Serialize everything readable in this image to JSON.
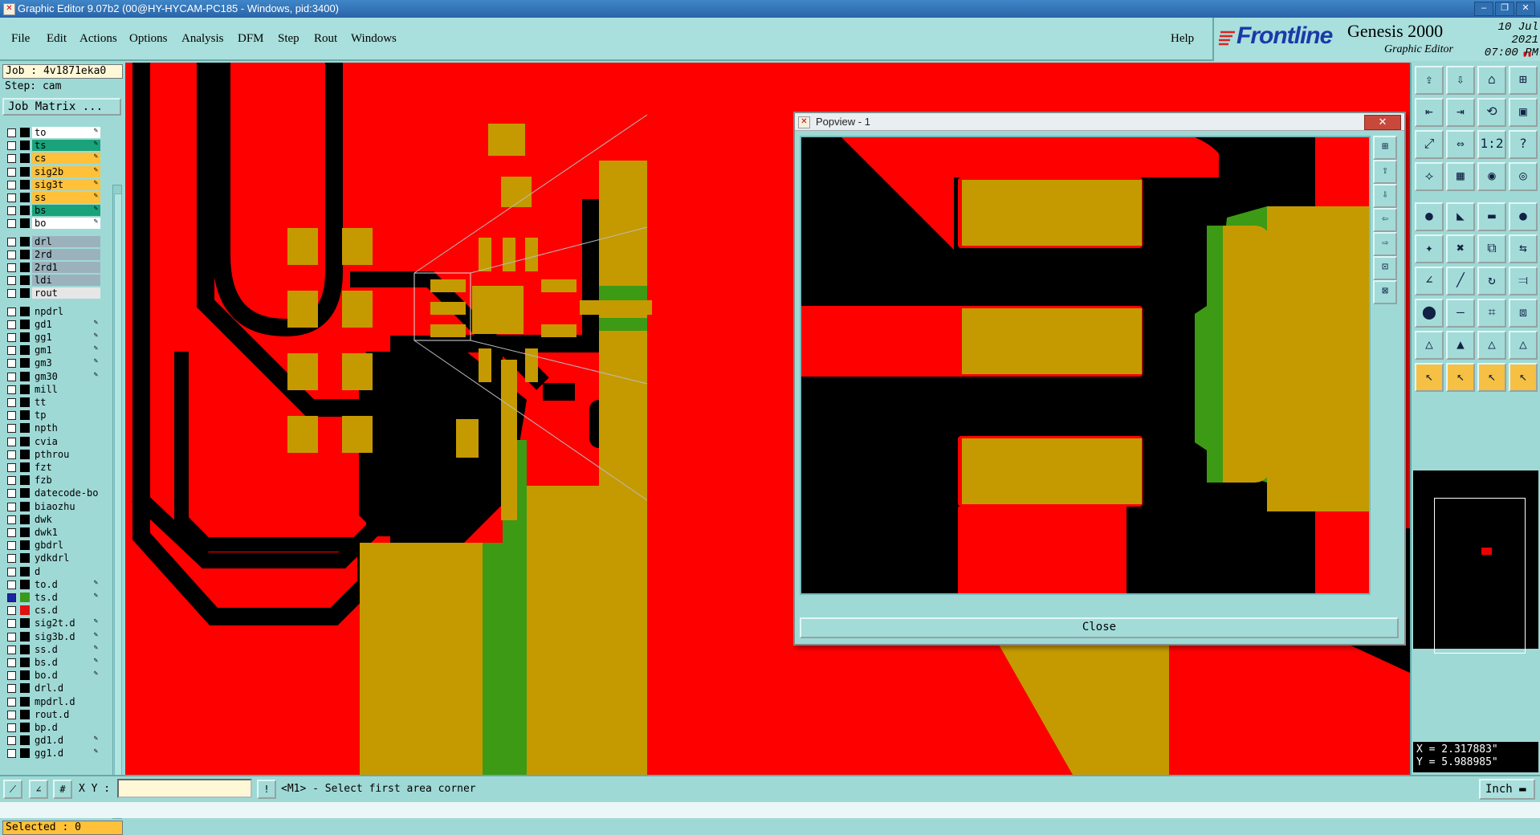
{
  "window": {
    "title": "Graphic Editor 9.07b2 (00@HY-HYCAM-PC185 - Windows, pid:3400)"
  },
  "menu": [
    "File",
    "Edit",
    "Actions",
    "Options",
    "Analysis",
    "DFM",
    "Step",
    "Rout",
    "Windows"
  ],
  "help": "Help",
  "brand": {
    "logo": "Frontline",
    "product": "Genesis 2000",
    "subtitle": "Graphic Editor",
    "date": "10 Jul 2021",
    "time": "07:00 PM"
  },
  "job": {
    "job_label": "Job : 4v1871eka0",
    "step_label": "Step: cam",
    "matrix_button": "Job Matrix ..."
  },
  "layers": [
    {
      "name": "to",
      "color": "#ffffff",
      "edit": true
    },
    {
      "name": "ts",
      "color": "#1aa37a",
      "edit": true
    },
    {
      "name": "cs",
      "color": "#ffc13a",
      "edit": true
    },
    {
      "name": "sig2b",
      "color": "#ffc13a",
      "edit": true
    },
    {
      "name": "sig3t",
      "color": "#ffc13a",
      "edit": true
    },
    {
      "name": "ss",
      "color": "#ffc13a",
      "edit": true
    },
    {
      "name": "bs",
      "color": "#1aa37a",
      "edit": true
    },
    {
      "name": "bo",
      "color": "#ffffff",
      "edit": true
    },
    {
      "name": "drl",
      "color": "#9bb2bd",
      "edit": false
    },
    {
      "name": "2rd",
      "color": "#9bb2bd",
      "edit": false
    },
    {
      "name": "2rd1",
      "color": "#9bb2bd",
      "edit": false
    },
    {
      "name": "ldi",
      "color": "#9bb2bd",
      "edit": false
    },
    {
      "name": "rout",
      "color": "#e6e6e6",
      "edit": false
    },
    {
      "name": "npdrl",
      "color": "#9fd9d6",
      "edit": false
    },
    {
      "name": "gd1",
      "color": "#9fd9d6",
      "edit": true
    },
    {
      "name": "gg1",
      "color": "#9fd9d6",
      "edit": true
    },
    {
      "name": "gm1",
      "color": "#9fd9d6",
      "edit": true
    },
    {
      "name": "gm3",
      "color": "#9fd9d6",
      "edit": true
    },
    {
      "name": "gm30",
      "color": "#9fd9d6",
      "edit": true
    },
    {
      "name": "mill",
      "color": "#9fd9d6",
      "edit": false
    },
    {
      "name": "tt",
      "color": "#9fd9d6",
      "edit": false
    },
    {
      "name": "tp",
      "color": "#9fd9d6",
      "edit": false
    },
    {
      "name": "npth",
      "color": "#9fd9d6",
      "edit": false
    },
    {
      "name": "cvia",
      "color": "#9fd9d6",
      "edit": false
    },
    {
      "name": "pthrou",
      "color": "#9fd9d6",
      "edit": false
    },
    {
      "name": "fzt",
      "color": "#9fd9d6",
      "edit": false
    },
    {
      "name": "fzb",
      "color": "#9fd9d6",
      "edit": false
    },
    {
      "name": "datecode-bo",
      "color": "#9fd9d6",
      "edit": false
    },
    {
      "name": "biaozhu",
      "color": "#9fd9d6",
      "edit": false
    },
    {
      "name": "dwk",
      "color": "#9fd9d6",
      "edit": false
    },
    {
      "name": "dwk1",
      "color": "#9fd9d6",
      "edit": false
    },
    {
      "name": "gbdrl",
      "color": "#9fd9d6",
      "edit": false
    },
    {
      "name": "ydkdrl",
      "color": "#9fd9d6",
      "edit": false
    },
    {
      "name": "d",
      "color": "#9fd9d6",
      "edit": false
    },
    {
      "name": "to.d",
      "color": "#9fd9d6",
      "edit": true
    },
    {
      "name": "ts.d",
      "color": "#9fd9d6",
      "edit": true,
      "active": true,
      "swatch": "#3a9a1a"
    },
    {
      "name": "cs.d",
      "color": "#9fd9d6",
      "edit": false,
      "swatch": "#e01010"
    },
    {
      "name": "sig2t.d",
      "color": "#9fd9d6",
      "edit": true
    },
    {
      "name": "sig3b.d",
      "color": "#9fd9d6",
      "edit": true
    },
    {
      "name": "ss.d",
      "color": "#9fd9d6",
      "edit": true
    },
    {
      "name": "bs.d",
      "color": "#9fd9d6",
      "edit": true
    },
    {
      "name": "bo.d",
      "color": "#9fd9d6",
      "edit": true
    },
    {
      "name": "drl.d",
      "color": "#9fd9d6",
      "edit": false
    },
    {
      "name": "mpdrl.d",
      "color": "#9fd9d6",
      "edit": false
    },
    {
      "name": "rout.d",
      "color": "#9fd9d6",
      "edit": false
    },
    {
      "name": "bp.d",
      "color": "#9fd9d6",
      "edit": false
    },
    {
      "name": "gd1.d",
      "color": "#9fd9d6",
      "edit": true
    },
    {
      "name": "gg1.d",
      "color": "#9fd9d6",
      "edit": true
    }
  ],
  "selected": "Selected : 0",
  "popview": {
    "title": "Popview - 1",
    "close_label": "Close"
  },
  "coords": {
    "x": "X = 2.317883\"",
    "y": "Y = 5.988985\""
  },
  "statusbar": {
    "xy_label": "X Y :",
    "xy_value": "",
    "message": "<M1> - Select first area corner",
    "unit": "Inch"
  },
  "colors": {
    "copper": "#ff0000",
    "pad": "#c59a00",
    "mask": "#3c9a14",
    "background": "#000000",
    "ui": "#9fd9d6"
  }
}
